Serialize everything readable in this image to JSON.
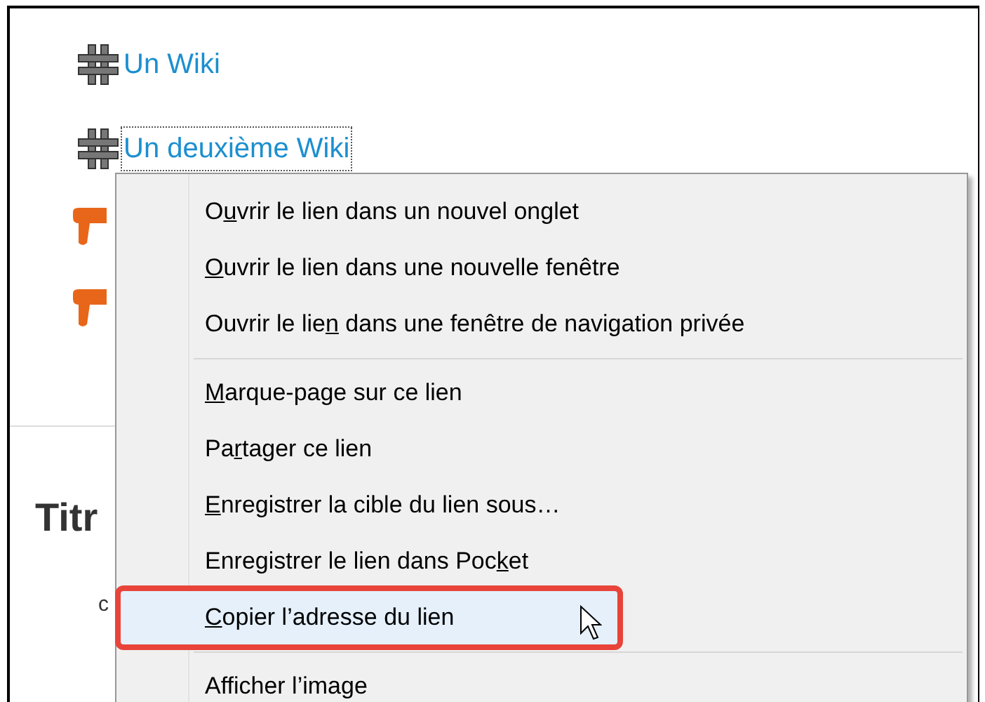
{
  "page": {
    "links": [
      {
        "label": "Un Wiki",
        "focused": false
      },
      {
        "label": "Un deuxième Wiki",
        "focused": true
      }
    ],
    "heading": "Titr",
    "text_fragment": "c"
  },
  "context_menu": {
    "items": [
      {
        "kind": "item",
        "before": "O",
        "key": "u",
        "after": "vrir le lien dans un nouvel onglet",
        "highlighted": false,
        "annotated": false
      },
      {
        "kind": "item",
        "key": "O",
        "after": "uvrir le lien dans une nouvelle fenêtre",
        "highlighted": false,
        "annotated": false
      },
      {
        "kind": "item",
        "before": "Ouvrir le lie",
        "key": "n",
        "after": " dans une fenêtre de navigation privée",
        "highlighted": false,
        "annotated": false
      },
      {
        "kind": "separator"
      },
      {
        "kind": "item",
        "key": "M",
        "after": "arque-page sur ce lien",
        "highlighted": false,
        "annotated": false
      },
      {
        "kind": "item",
        "before": "Pa",
        "key": "r",
        "after": "tager ce lien",
        "highlighted": false,
        "annotated": false
      },
      {
        "kind": "item",
        "key": "E",
        "after": "nregistrer la cible du lien sous…",
        "highlighted": false,
        "annotated": false
      },
      {
        "kind": "item",
        "before": "Enregistrer le lien dans Poc",
        "key": "k",
        "after": "et",
        "highlighted": false,
        "annotated": false
      },
      {
        "kind": "item",
        "key": "C",
        "after": "opier l’adresse du lien",
        "highlighted": true,
        "annotated": true
      },
      {
        "kind": "separator"
      },
      {
        "kind": "item",
        "before": "Afficher l’image",
        "highlighted": false,
        "annotated": false
      }
    ]
  }
}
